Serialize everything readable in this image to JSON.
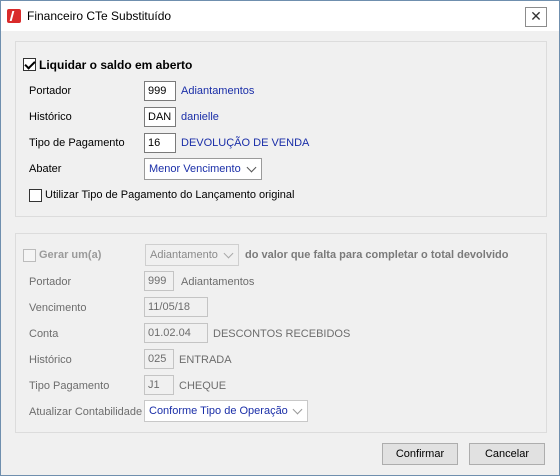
{
  "window": {
    "title": "Financeiro CTe Substituído",
    "close_glyph": "✕"
  },
  "section1": {
    "checkbox_label": "Liquidar o saldo em aberto",
    "checkbox_checked": true,
    "portador": {
      "label": "Portador",
      "code": "999",
      "desc": "Adiantamentos"
    },
    "historico": {
      "label": "Histórico",
      "code": "DAN",
      "desc": "danielle"
    },
    "tipo_pagamento": {
      "label": "Tipo de Pagamento",
      "code": "16",
      "desc": "DEVOLUÇÃO DE VENDA"
    },
    "abater": {
      "label": "Abater",
      "value": "Menor Vencimento"
    },
    "utilizar_label": "Utilizar Tipo de Pagamento do Lançamento original"
  },
  "section2": {
    "gerar_label": "Gerar um(a)",
    "gerar_combo": "Adiantamento",
    "gerar_suffix": "do valor que falta para completar o total devolvido",
    "portador": {
      "label": "Portador",
      "code": "999",
      "desc": "Adiantamentos"
    },
    "vencimento": {
      "label": "Vencimento",
      "value": "11/05/18"
    },
    "conta": {
      "label": "Conta",
      "code": "01.02.04",
      "desc": "DESCONTOS RECEBIDOS"
    },
    "historico": {
      "label": "Histórico",
      "code": "025",
      "desc": "ENTRADA"
    },
    "tipo_pagamento": {
      "label": "Tipo Pagamento",
      "code": "J1",
      "desc": "CHEQUE"
    },
    "atualizar": {
      "label": "Atualizar Contabilidade",
      "value": "Conforme Tipo de Operação"
    }
  },
  "buttons": {
    "confirm": "Confirmar",
    "cancel": "Cancelar"
  },
  "colors": {
    "accent_text": "#1a2ea8",
    "disabled_text": "#6d6d6d",
    "app_icon": "#d92b2b"
  }
}
